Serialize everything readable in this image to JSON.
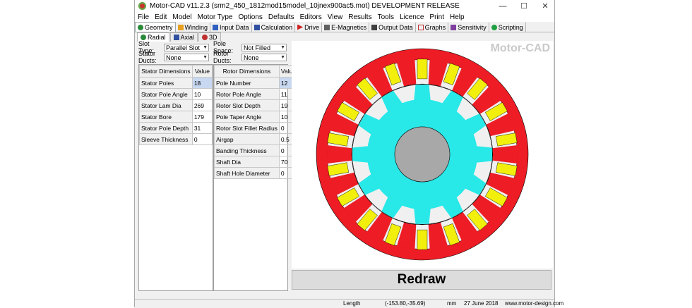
{
  "window": {
    "title": "Motor-CAD v11.2.3 (srm2_450_1812mod15model_10jnex900ac5.mot) DEVELOPMENT RELEASE",
    "controls": [
      "—",
      "☐",
      "✕"
    ]
  },
  "menu": [
    "File",
    "Edit",
    "Model",
    "Motor Type",
    "Options",
    "Defaults",
    "Editors",
    "View",
    "Results",
    "Tools",
    "Licence",
    "Print",
    "Help"
  ],
  "tabs": [
    {
      "label": "Geometry",
      "icon": "geometry-icon",
      "color": "#2a8a3a"
    },
    {
      "label": "Winding",
      "icon": "winding-icon",
      "color": "#e8a020"
    },
    {
      "label": "Input Data",
      "icon": "input-data-icon",
      "color": "#3060c0"
    },
    {
      "label": "Calculation",
      "icon": "calculation-icon",
      "color": "#3050a0"
    },
    {
      "label": "Drive",
      "icon": "drive-icon",
      "color": "#d02020"
    },
    {
      "label": "E-Magnetics",
      "icon": "e-magnetics-icon",
      "color": "#606060"
    },
    {
      "label": "Output Data",
      "icon": "output-data-icon",
      "color": "#404040"
    },
    {
      "label": "Graphs",
      "icon": "graphs-icon",
      "color": "#c03030"
    },
    {
      "label": "Sensitivity",
      "icon": "sensitivity-icon",
      "color": "#8040a0"
    },
    {
      "label": "Scripting",
      "icon": "scripting-icon",
      "color": "#20a040"
    }
  ],
  "subtabs": [
    "Radial",
    "Axial",
    "3D"
  ],
  "stator_fields": {
    "slot_type_label": "Slot Type:",
    "slot_type_value": "Parallel Slot",
    "ducts_label": "Stator Ducts:",
    "ducts_value": "None"
  },
  "rotor_fields": {
    "pole_space_label": "Pole Space:",
    "pole_space_value": "Not Filled",
    "ducts_label": "Rotor Ducts:",
    "ducts_value": "None"
  },
  "stator_table": {
    "headers": [
      "Stator Dimensions",
      "Value"
    ],
    "rows": [
      [
        "Stator Poles",
        "18"
      ],
      [
        "Stator Pole Angle",
        "10"
      ],
      [
        "Stator Lam Dia",
        "269"
      ],
      [
        "Stator Bore",
        "179"
      ],
      [
        "Stator Pole Depth",
        "31"
      ],
      [
        "Sleeve Thickness",
        "0"
      ]
    ]
  },
  "rotor_table": {
    "headers": [
      "Rotor Dimensions",
      "Value"
    ],
    "rows": [
      [
        "Pole Number",
        "12"
      ],
      [
        "Rotor Pole Angle",
        "11"
      ],
      [
        "Rotor Slot Depth",
        "19"
      ],
      [
        "Pole Taper Angle",
        "10"
      ],
      [
        "Rotor Slot Fillet Radius",
        "0"
      ],
      [
        "Airgap",
        "0.5"
      ],
      [
        "Banding Thickness",
        "0"
      ],
      [
        "Shaft Dia",
        "70"
      ],
      [
        "Shaft Hole Diameter",
        "0"
      ]
    ]
  },
  "drawing": {
    "brand": "Motor-CAD",
    "colors": {
      "stator": "#ee1c24",
      "coil": "#f2ef0c",
      "rotor": "#28e8e8",
      "shaft": "#a8a8a8",
      "slot": "#f0f0f0"
    }
  },
  "redraw_label": "Redraw",
  "status": {
    "length_label": "Length",
    "coords": "(-153.80,-35.69)",
    "unit": "mm",
    "date": "27 June 2018",
    "website": "www.motor-design.com"
  }
}
